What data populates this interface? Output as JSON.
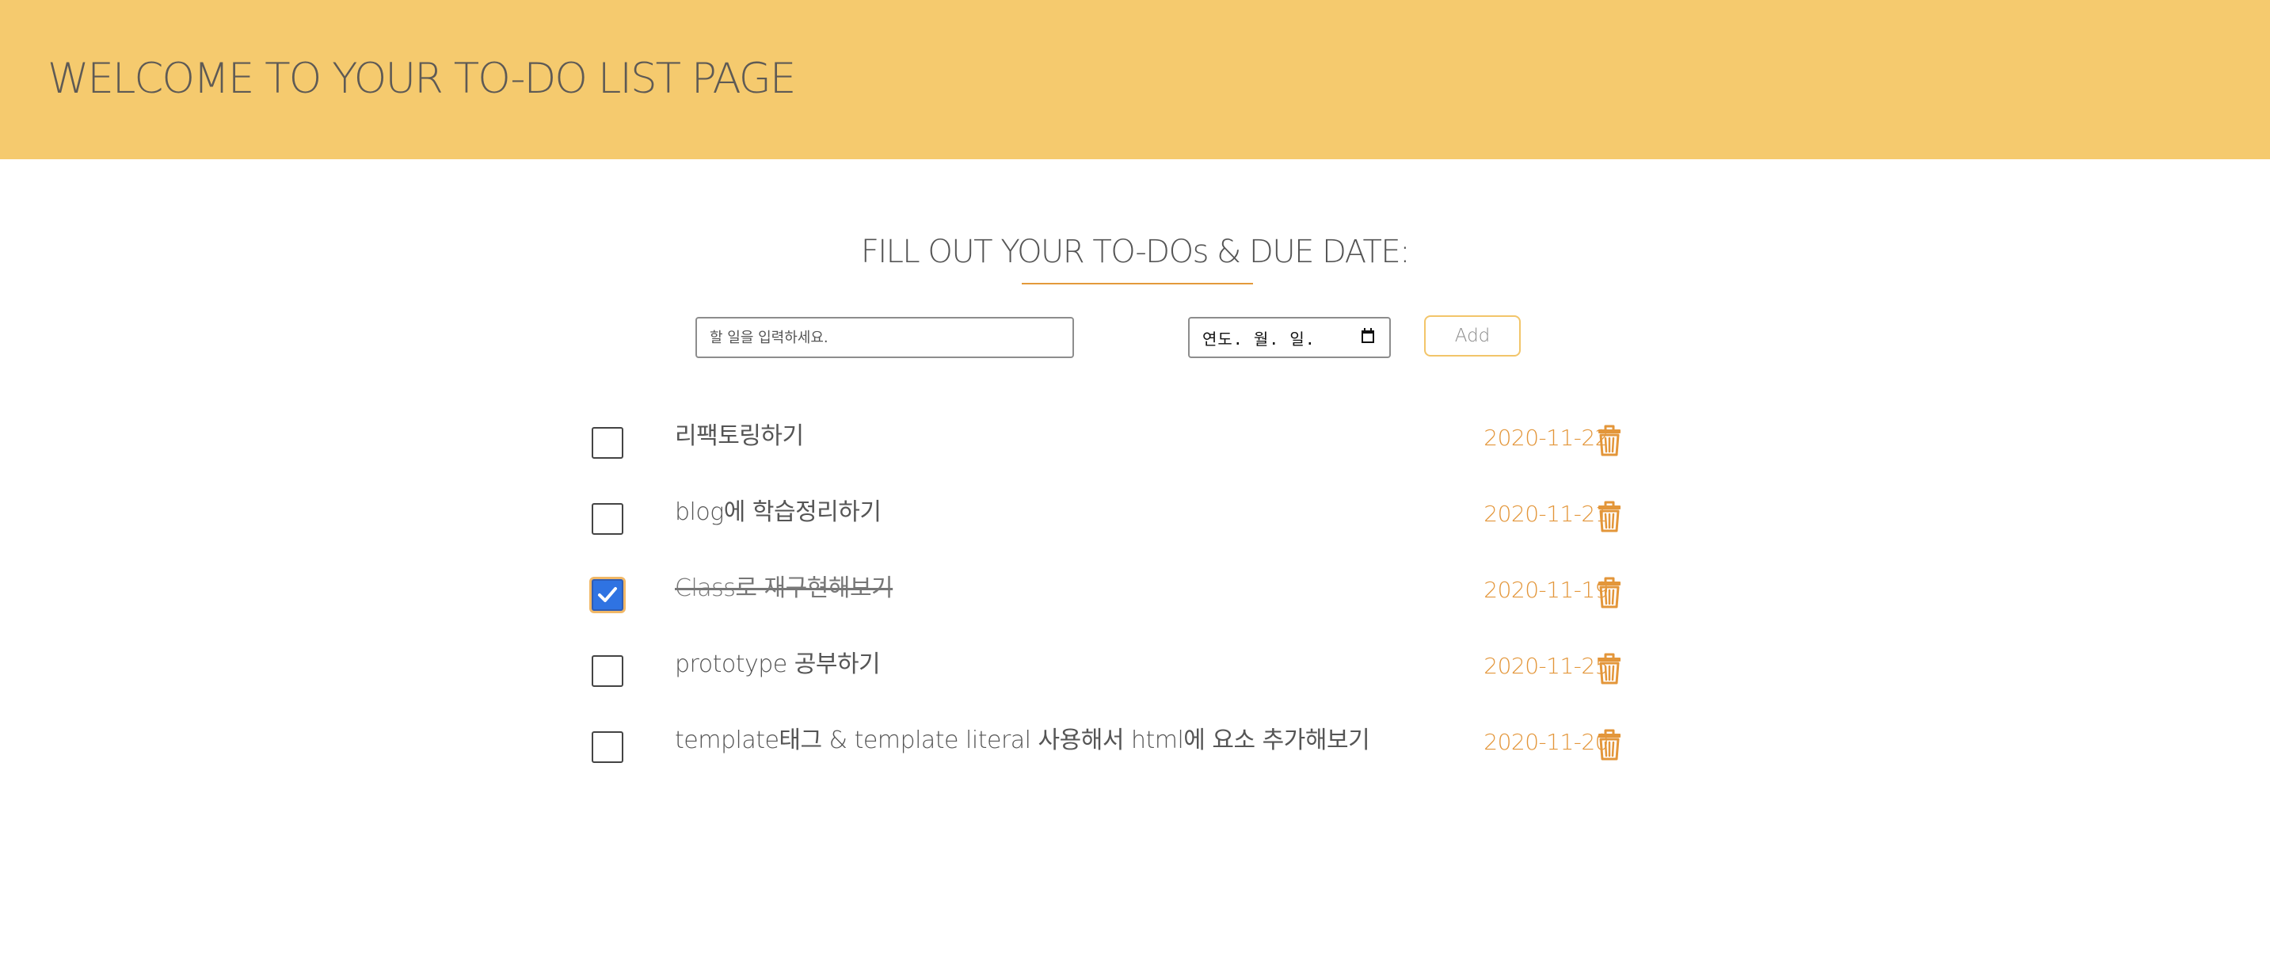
{
  "header": {
    "title": "WELCOME TO YOUR TO-DO LIST PAGE"
  },
  "form": {
    "title": "FILL OUT YOUR TO-DOs & DUE DATE:",
    "todo_placeholder": "할 일을 입력하세요.",
    "date_placeholder": "연도. 월. 일.",
    "add_label": "Add"
  },
  "todos": [
    {
      "text": "리팩토링하기",
      "date": "2020-11-22",
      "checked": false
    },
    {
      "text": "blog에 학습정리하기",
      "date": "2020-11-21",
      "checked": false
    },
    {
      "text": "Class로 재구현해보기",
      "date": "2020-11-19",
      "checked": true
    },
    {
      "text": "prototype 공부하기",
      "date": "2020-11-25",
      "checked": false
    },
    {
      "text": "template태그 & template literal 사용해서 html에 요소 추가해보기",
      "date": "2020-11-20",
      "checked": false
    }
  ],
  "colors": {
    "header_bg": "#f5ca6e",
    "accent": "#e3963a",
    "checked": "#2f73e2"
  },
  "icons": {
    "delete": "trash-icon",
    "calendar": "calendar-icon",
    "check": "check-icon"
  }
}
